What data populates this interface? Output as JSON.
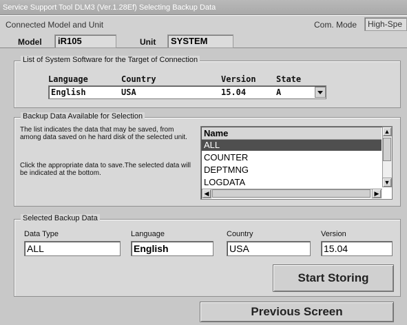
{
  "window": {
    "title": "Service Support Tool DLM3 (Ver.1.28Ef) Selecting Backup Data"
  },
  "top": {
    "connected_label": "Connected Model and Unit",
    "com_mode_label": "Com. Mode",
    "com_mode_value": "High-Spe",
    "model_label": "Model",
    "model_value": "iR105",
    "unit_label": "Unit",
    "unit_value": "SYSTEM"
  },
  "system_software": {
    "legend": "List of System Software for the Target of Connection",
    "headers": [
      "Language",
      "Country",
      "Version",
      "State"
    ],
    "row": [
      "English",
      "USA",
      "15.04",
      "A"
    ]
  },
  "backup_available": {
    "legend": "Backup Data Available for Selection",
    "desc1": "The list indicates the data that may be saved, from among data saved on he hard disk of the selected unit.",
    "desc2": "Click the appropriate data to save.The selected data will be indicated at the bottom.",
    "list_header": "Name",
    "items": [
      "ALL",
      "COUNTER",
      "DEPTMNG",
      "LOGDATA"
    ]
  },
  "selected_backup": {
    "legend": "Selected Backup Data",
    "labels": {
      "data_type": "Data Type",
      "language": "Language",
      "country": "Country",
      "version": "Version"
    },
    "values": {
      "data_type": "ALL",
      "language": "English",
      "country": "USA",
      "version": "15.04"
    },
    "start_button": "Start Storing"
  },
  "footer": {
    "previous_button": "Previous Screen"
  },
  "colors": {
    "selected_row": "#4f4f4f",
    "window_bg": "#c8c8c8"
  }
}
